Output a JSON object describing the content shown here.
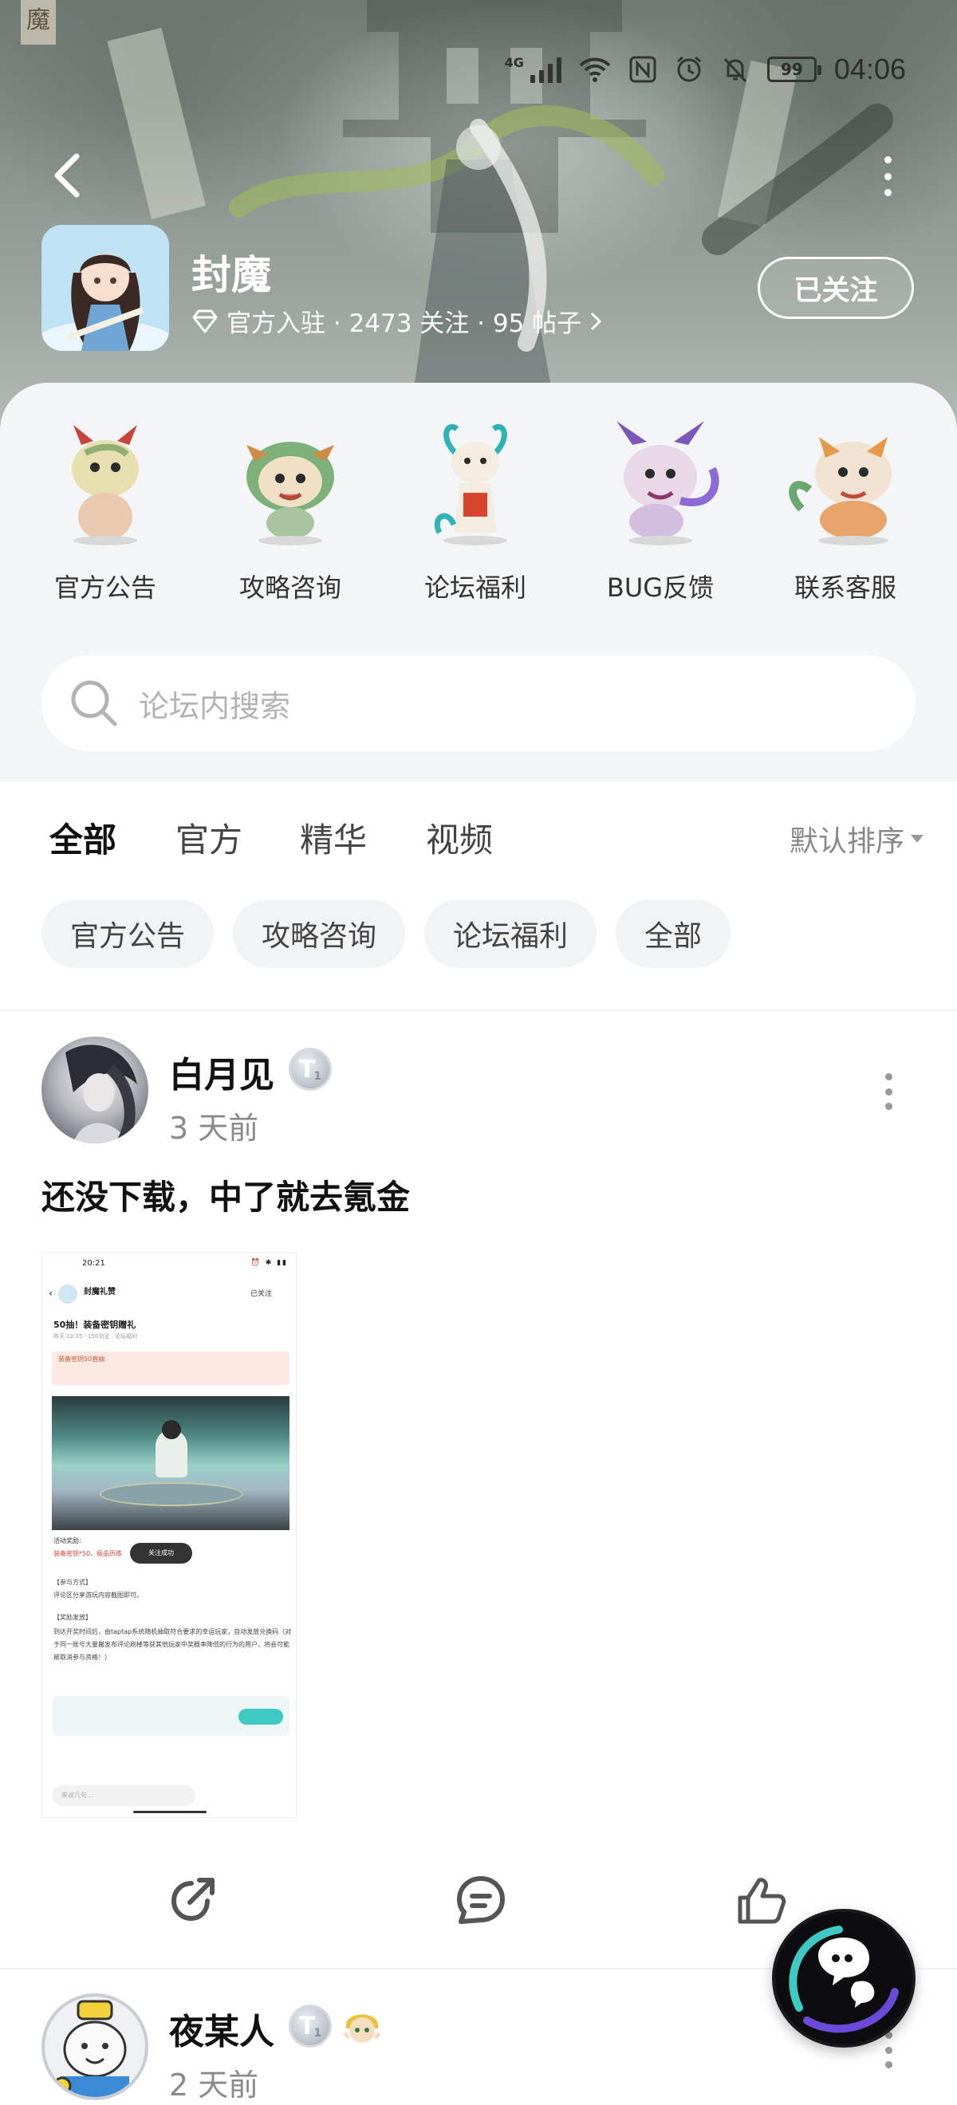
{
  "status_bar": {
    "network": "4G",
    "battery": "99",
    "time": "04:06",
    "icons": [
      "signal-icon",
      "wifi-icon",
      "nfc-icon",
      "alarm-icon",
      "mute-icon",
      "battery-icon"
    ]
  },
  "header": {
    "corner_logo_text": "魔",
    "game_name": "封魔",
    "meta_text": "官方入驻 · 2473 关注 · 95 帖子",
    "follow_label": "已关注"
  },
  "categories": [
    {
      "label": "官方公告",
      "icon": "pet-dragon-icon"
    },
    {
      "label": "攻略咨询",
      "icon": "pet-lion-icon"
    },
    {
      "label": "论坛福利",
      "icon": "pet-qilin-icon"
    },
    {
      "label": "BUG反馈",
      "icon": "pet-beast-icon"
    },
    {
      "label": "联系客服",
      "icon": "pet-tiger-icon"
    }
  ],
  "search": {
    "placeholder": "论坛内搜索"
  },
  "tabs": [
    {
      "label": "全部",
      "active": true
    },
    {
      "label": "官方",
      "active": false
    },
    {
      "label": "精华",
      "active": false
    },
    {
      "label": "视频",
      "active": false
    }
  ],
  "sort_label": "默认排序",
  "filter_chips": [
    "官方公告",
    "攻略咨询",
    "论坛福利",
    "全部"
  ],
  "posts": [
    {
      "author": "白月见",
      "level": "T",
      "level_num": "1",
      "time": "3 天前",
      "title": "还没下载，中了就去氪金",
      "screenshot": {
        "time": "20:21",
        "account": "封魔礼赞",
        "follow": "已关注",
        "post_title": "50抽！装备密钥赠礼",
        "post_sub": "昨天 23:35 · 150浏览 · 论坛福利",
        "card_text": "装备密钥50直抽",
        "reward_label": "活动奖励:",
        "reward_text": "装备密钥*50、极品历练",
        "toast": "关注成功",
        "join_label": "【参与方式】",
        "join_text": "评论区分享游玩内容截图即可。",
        "rules_label": "【奖励发放】",
        "rules_text": "到达开奖时间后，由taptap系统随机抽取符合要求的幸运玩家，自动发放兑换码（对于同一账号大量搬发布评论刷楼等获其他玩家中奖概率降低的行为的用户，将会可能被取消参与资格！）",
        "comment_placeholder": "来说几句..."
      }
    },
    {
      "author": "夜某人",
      "level": "T",
      "level_num": "1",
      "time": "2 天前"
    }
  ]
}
